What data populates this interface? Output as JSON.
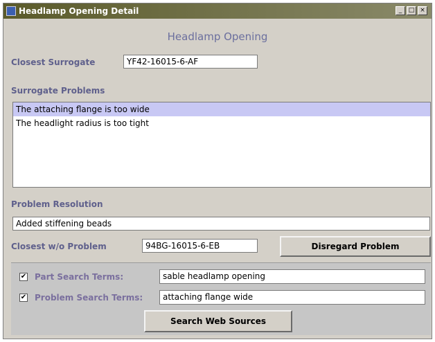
{
  "window": {
    "title": "Headlamp Opening Detail"
  },
  "titlebar_buttons": {
    "minimize": "_",
    "maximize": "□",
    "close": "×"
  },
  "heading": "Headlamp Opening",
  "closest_surrogate": {
    "label": "Closest Surrogate",
    "value": "YF42-16015-6-AF"
  },
  "surrogate_problems": {
    "label": "Surrogate Problems",
    "items": [
      "The attaching flange is too wide",
      "The headlight radius is too tight"
    ]
  },
  "problem_resolution": {
    "label": "Problem Resolution",
    "value": "Added stiffening beads"
  },
  "closest_wo_problem": {
    "label": "Closest w/o Problem",
    "value": "94BG-16015-6-EB"
  },
  "disregard_button": "Disregard Problem",
  "search": {
    "part_terms": {
      "label": "Part Search Terms:",
      "value": "sable headlamp opening",
      "checked": true
    },
    "problem_terms": {
      "label": "Problem Search Terms:",
      "value": "attaching flange wide",
      "checked": true
    },
    "check_glyph": "✔",
    "button": "Search Web Sources"
  }
}
